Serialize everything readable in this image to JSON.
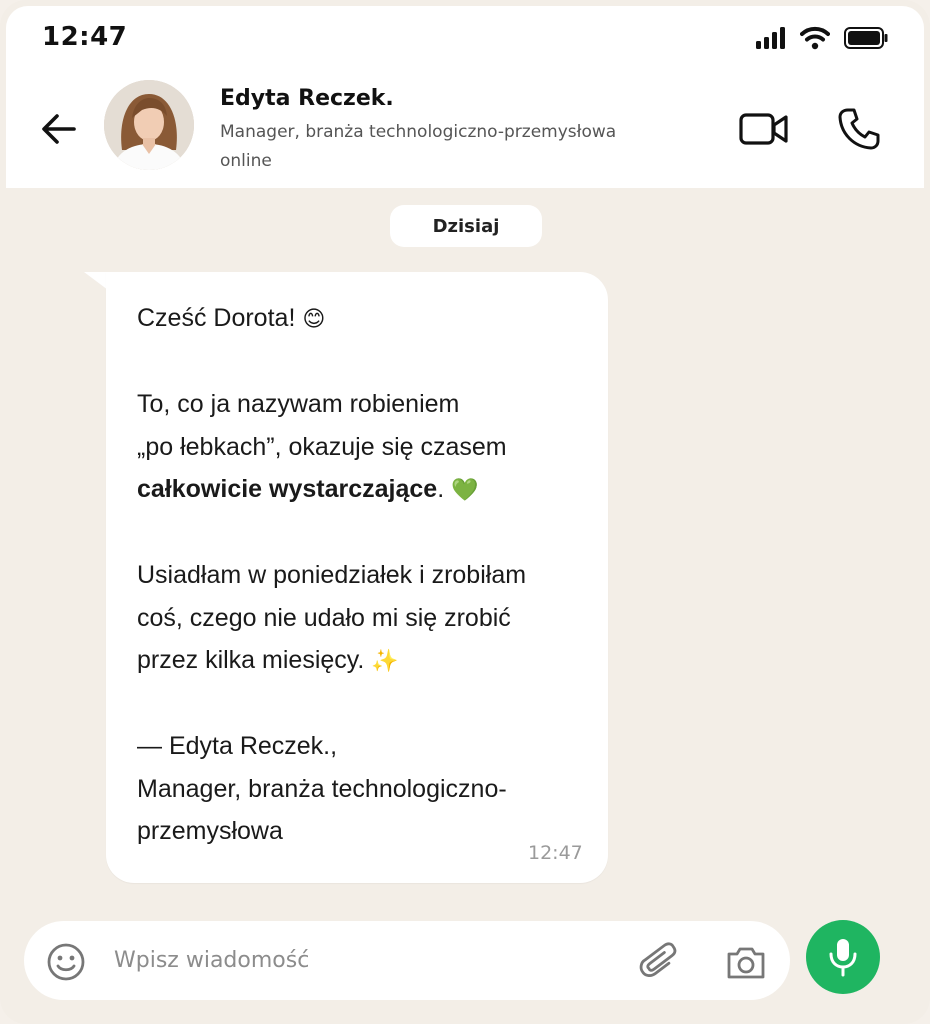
{
  "status_bar": {
    "time": "12:47"
  },
  "contact": {
    "name": "Edyta Reczek.",
    "role": "Manager, branża technologiczno-przemysłowa",
    "presence": "online"
  },
  "date_divider": "Dzisiaj",
  "message": {
    "greeting": "Cześć Dorota!",
    "greeting_emoji": "😊",
    "p2_line1": "To, co ja nazywam robieniem",
    "p2_line2": "„po łebkach”, okazuje się czasem",
    "p2_bold": "całkowicie wystarczające",
    "p2_end": ".",
    "p2_emoji": "💚",
    "p3_line1": "Usiadłam w poniedziałek i zrobiłam",
    "p3_line2": "coś, czego nie udało mi się zrobić",
    "p3_line3": "przez kilka miesięcy.",
    "p3_emoji": "✨",
    "sig_line1": "— Edyta Reczek.,",
    "sig_line2": "Manager, branża technologiczno-",
    "sig_line3": "przemysłowa",
    "time": "12:47"
  },
  "composer": {
    "placeholder": "Wpisz wiadomość"
  },
  "icons": [
    "signal-icon",
    "wifi-icon",
    "battery-icon",
    "back-arrow-icon",
    "video-call-icon",
    "phone-icon",
    "emoji-icon",
    "paperclip-icon",
    "camera-icon",
    "microphone-icon"
  ],
  "colors": {
    "accent": "#1fb561",
    "background": "#f3eee7",
    "bubble": "#ffffff"
  }
}
